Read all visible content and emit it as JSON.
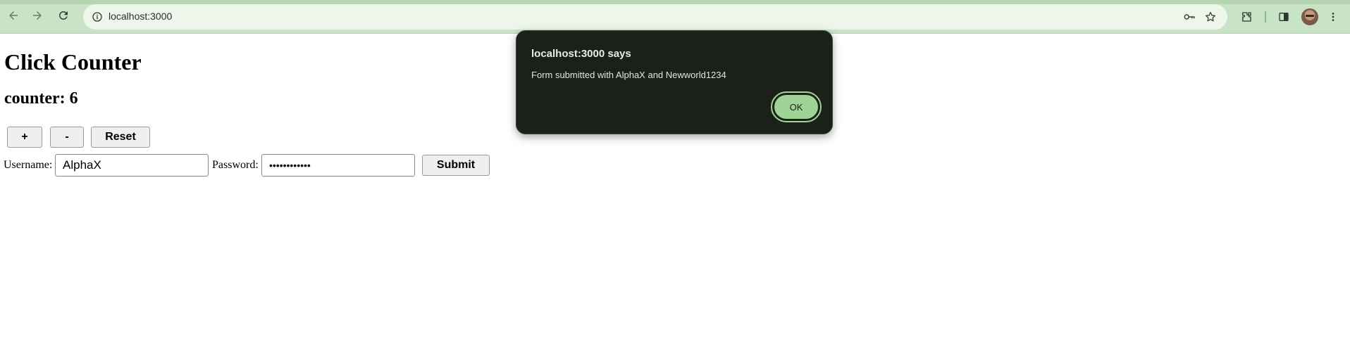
{
  "browser": {
    "url": "localhost:3000",
    "icons": {
      "back": "arrow-left-icon",
      "forward": "arrow-right-icon",
      "reload": "reload-icon",
      "site_info": "info-icon",
      "password": "key-icon",
      "bookmark": "star-icon",
      "extensions": "puzzle-icon",
      "side_panel": "side-panel-icon",
      "menu": "kebab-menu-icon"
    },
    "theme_color": "#c9e3c6"
  },
  "page": {
    "title": "Click Counter",
    "counter_text": "counter: 6",
    "buttons": {
      "increment": "+",
      "decrement": "-",
      "reset": "Reset"
    },
    "form": {
      "username_label": "Username:",
      "username_value": "AlphaX",
      "password_label": "Password:",
      "password_value": "••••••••••••",
      "submit_label": "Submit"
    }
  },
  "dialog": {
    "title": "localhost:3000 says",
    "message": "Form submitted with AlphaX and Newworld1234",
    "ok_label": "OK",
    "background": "#1b2019",
    "accent": "#9ed495"
  }
}
